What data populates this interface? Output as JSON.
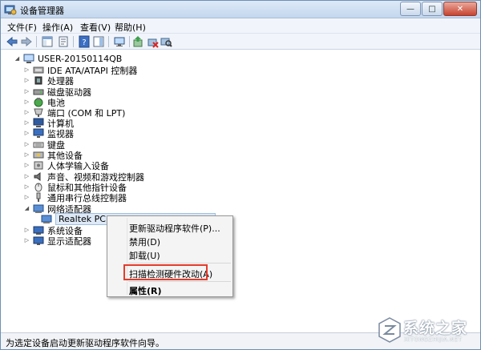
{
  "window": {
    "title": "设备管理器",
    "controls": {
      "minimize": "—",
      "maximize": "□",
      "close": "✕"
    }
  },
  "menu": {
    "items": [
      "文件(F)",
      "操作(A)",
      "查看(V)",
      "帮助(H)"
    ]
  },
  "toolbar": {
    "buttons": [
      "back-icon",
      "forward-icon",
      "show-hide-console-tree-icon",
      "properties-icon",
      "help-icon",
      "show-action-pane-icon",
      "monitor-icon",
      "update-driver-icon",
      "uninstall-icon",
      "scan-hardware-icon"
    ]
  },
  "tree": {
    "root": "USER-20150114QB",
    "categories": [
      {
        "label": "IDE ATA/ATAPI 控制器",
        "icon": "ide-controller-icon"
      },
      {
        "label": "处理器",
        "icon": "processor-icon"
      },
      {
        "label": "磁盘驱动器",
        "icon": "disk-drive-icon"
      },
      {
        "label": "电池",
        "icon": "battery-icon"
      },
      {
        "label": "端口 (COM 和 LPT)",
        "icon": "port-icon"
      },
      {
        "label": "计算机",
        "icon": "computer-icon"
      },
      {
        "label": "监视器",
        "icon": "monitor-icon"
      },
      {
        "label": "键盘",
        "icon": "keyboard-icon"
      },
      {
        "label": "其他设备",
        "icon": "other-devices-icon"
      },
      {
        "label": "人体学输入设备",
        "icon": "hid-icon"
      },
      {
        "label": "声音、视频和游戏控制器",
        "icon": "sound-icon"
      },
      {
        "label": "鼠标和其他指针设备",
        "icon": "mouse-icon"
      },
      {
        "label": "通用串行总线控制器",
        "icon": "usb-icon"
      },
      {
        "label": "网络适配器",
        "icon": "network-adapter-icon"
      },
      {
        "label": "系统设备",
        "icon": "system-devices-icon"
      },
      {
        "label": "显示适配器",
        "icon": "display-adapter-icon"
      }
    ],
    "network_child": {
      "label": "Realtek PCIe GBE Family Controller",
      "icon": "network-card-icon"
    }
  },
  "context_menu": {
    "items": [
      "更新驱动程序软件(P)...",
      "禁用(D)",
      "卸载(U)",
      "扫描检测硬件改动(A)",
      "属性(R)"
    ]
  },
  "status": {
    "text": "为选定设备启动更新驱动程序软件向导。"
  },
  "watermark": {
    "text": "系统之家",
    "sub": "XITONGZHIJIA.NET"
  }
}
